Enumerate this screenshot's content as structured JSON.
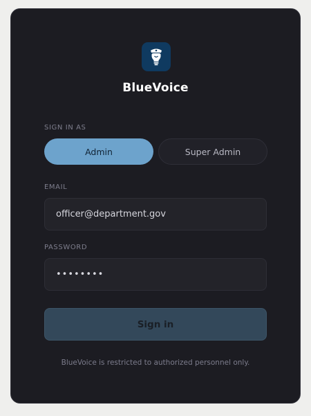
{
  "brand": {
    "name": "BlueVoice",
    "logo_icon": "officer-bulb-icon",
    "logo_color": "#0f3a60"
  },
  "sign_in_as": {
    "label": "SIGN IN AS",
    "options": [
      {
        "label": "Admin",
        "selected": true
      },
      {
        "label": "Super Admin",
        "selected": false
      }
    ]
  },
  "email": {
    "label": "EMAIL",
    "value": "officer@department.gov"
  },
  "password": {
    "label": "PASSWORD",
    "value": "••••••••"
  },
  "submit": {
    "label": "Sign in"
  },
  "footer": {
    "notice": "BlueVoice is restricted to authorized personnel only."
  },
  "colors": {
    "accent": "#6da3cc",
    "card_background": "#1c1c22",
    "page_background": "#efefed"
  }
}
